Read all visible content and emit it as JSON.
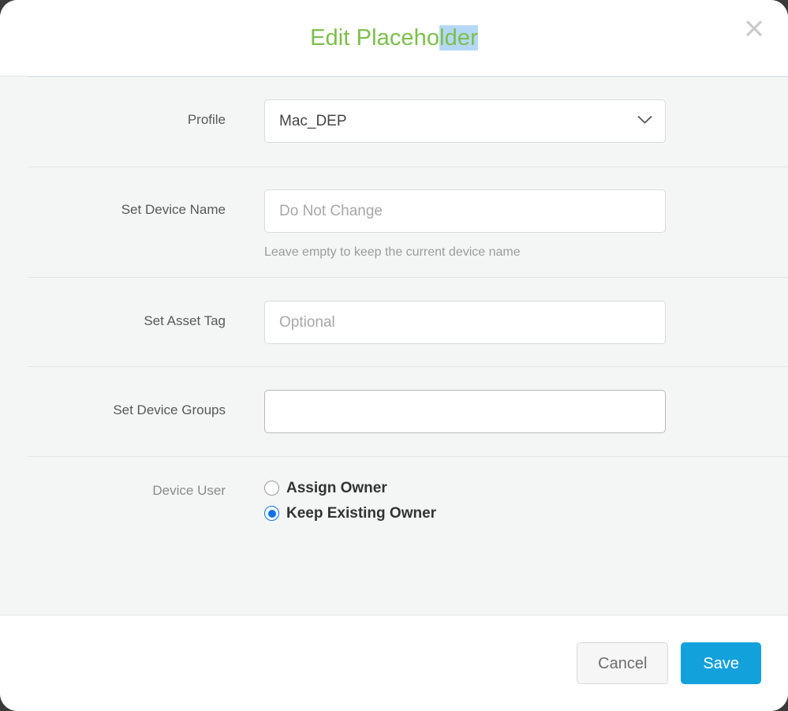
{
  "dialog": {
    "title_plain": "Edit Placeho",
    "title_selected": "lder",
    "title_full": "Edit Placeholder",
    "close_icon": "close-icon",
    "accent_green": "#7cbe4c",
    "selection_highlight": "#b6d8f7"
  },
  "form": {
    "profile": {
      "label": "Profile",
      "value": "Mac_DEP",
      "options": [
        "Mac_DEP"
      ],
      "chevron_icon": "chevron-down-icon"
    },
    "device_name": {
      "label": "Set Device Name",
      "value": "",
      "placeholder": "Do Not Change",
      "help": "Leave empty to keep the current device name"
    },
    "asset_tag": {
      "label": "Set Asset Tag",
      "value": "",
      "placeholder": "Optional"
    },
    "device_groups": {
      "label": "Set Device Groups",
      "value": "",
      "placeholder": ""
    },
    "device_user": {
      "label": "Device User",
      "options": [
        {
          "label": "Assign Owner",
          "checked": false
        },
        {
          "label": "Keep Existing Owner",
          "checked": true
        }
      ],
      "selected": "Keep Existing Owner",
      "radio_color": "#0b72e8"
    }
  },
  "footer": {
    "cancel_label": "Cancel",
    "save_label": "Save",
    "save_color": "#13a1dc"
  }
}
